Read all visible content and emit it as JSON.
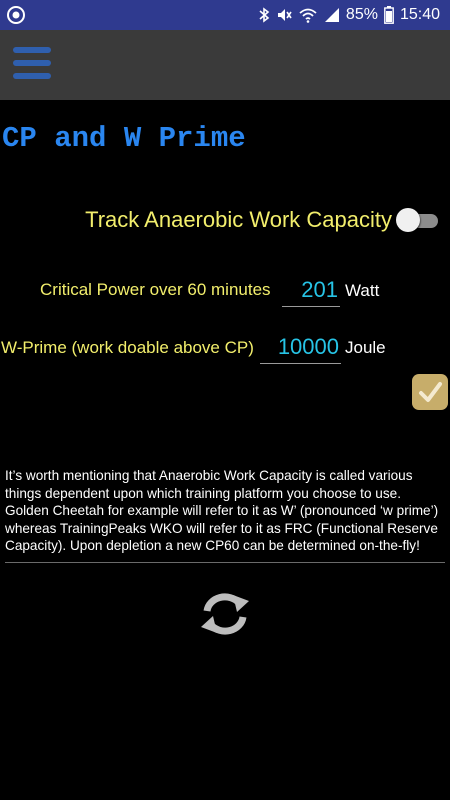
{
  "status_bar": {
    "battery": "85%",
    "time": "15:40",
    "icons": [
      "app-status-icon",
      "bluetooth-icon",
      "mute-icon",
      "wifi-icon",
      "signal-icon",
      "battery-icon"
    ]
  },
  "app_bar": {
    "menu_icon": "hamburger-menu-icon"
  },
  "page": {
    "title": "CP and W Prime",
    "toggle": {
      "label": "Track Anaerobic Work Capacity",
      "on": false
    },
    "critical_power": {
      "label": "Critical Power over 60 minutes",
      "value": "201",
      "unit": "Watt"
    },
    "w_prime": {
      "label": "W-Prime (work doable above CP)",
      "value": "10000",
      "unit": "Joule"
    },
    "confirm_icon": "checkmark-icon",
    "info": "It’s worth mentioning that Anaerobic Work Capacity is called various things dependent upon which training platform you choose to use. Golden Cheetah for example will refer to it as W’ (pronounced ‘w prime’) whereas TrainingPeaks WKO will refer to it as FRC (Functional Reserve Capacity). Upon depletion a new CP60 can be determined on-the-fly!",
    "refresh_icon": "refresh-icon"
  },
  "colors": {
    "status_bar": "#2f3a8f",
    "app_bar": "#3a3a3a",
    "title": "#2a86f0",
    "label": "#f2ee6c",
    "input_value": "#27c4e6",
    "check_button": "#c7ad6a",
    "background": "#000000"
  }
}
